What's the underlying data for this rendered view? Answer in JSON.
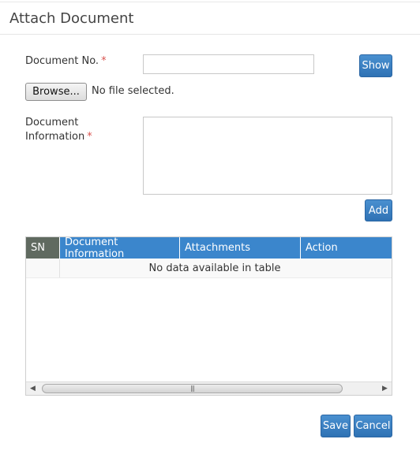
{
  "modal": {
    "title": "Attach Document"
  },
  "form": {
    "doc_no_label": "Document No.",
    "doc_no_value": "",
    "required_mark": "*",
    "show_button": "Show",
    "browse_button": "Browse...",
    "file_status": "No file selected.",
    "doc_info_label_line1": "Document",
    "doc_info_label_line2": "Information",
    "doc_info_value": "",
    "add_button": "Add"
  },
  "table": {
    "columns": [
      "SN",
      "Document Information",
      "Attachments",
      "Action"
    ],
    "empty_message": "No data available in table",
    "scroll_grip": "|||"
  },
  "footer": {
    "save_button": "Save",
    "cancel_button": "Cancel"
  },
  "colors": {
    "primary": "#3a7fc1",
    "sn_header": "#606a60",
    "required": "#d9534f"
  },
  "icons": {
    "scroll_left": "triangle-left",
    "scroll_right": "triangle-right"
  }
}
